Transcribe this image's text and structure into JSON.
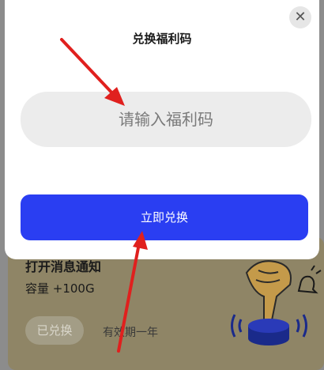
{
  "modal": {
    "title": "兑换福利码",
    "close_icon": "close-icon",
    "input_placeholder": "请输入福利码",
    "redeem_label": "立即兑换"
  },
  "background_card": {
    "title": "打开消息通知",
    "reward": "容量 +100G",
    "status_button": "已兑换",
    "validity": "有效期一年",
    "illustration_icon": "hand-press-bell-icon"
  },
  "annotations": {
    "arrow_color": "#e0201e"
  },
  "colors": {
    "accent": "#2a3ef2",
    "card_bg": "#8f8566"
  }
}
